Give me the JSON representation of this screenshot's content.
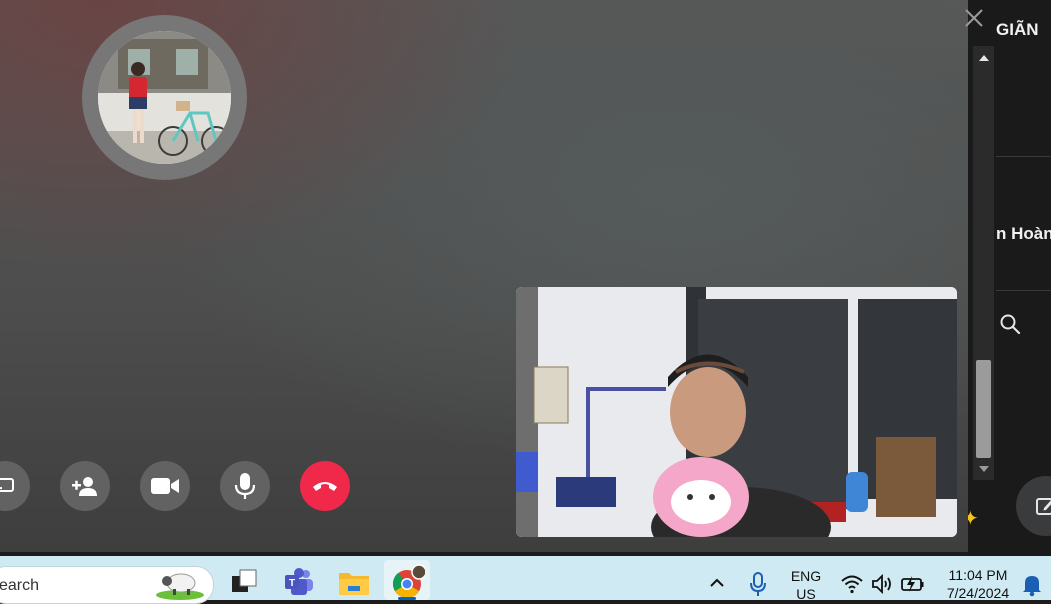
{
  "background_app": {
    "heading_fragment": "GIÃN",
    "name_fragment": "n Hoàn",
    "icons": [
      "search-icon",
      "compose-icon",
      "sparkle-icon"
    ]
  },
  "call": {
    "controls": [
      {
        "name": "share-screen",
        "icon": "screen-share-icon"
      },
      {
        "name": "add-person",
        "icon": "add-person-icon"
      },
      {
        "name": "video",
        "icon": "video-camera-icon"
      },
      {
        "name": "microphone",
        "icon": "microphone-icon"
      },
      {
        "name": "end-call",
        "icon": "phone-hangup-icon"
      }
    ],
    "colors": {
      "end_call": "#f02849",
      "control_bg": "#626262"
    }
  },
  "taskbar": {
    "search_text": "earch",
    "apps": [
      "task-view-icon",
      "teams-icon",
      "file-explorer-icon",
      "chrome-icon"
    ],
    "tray": {
      "language_line1": "ENG",
      "language_line2": "US",
      "time": "11:04 PM",
      "date": "7/24/2024"
    }
  }
}
